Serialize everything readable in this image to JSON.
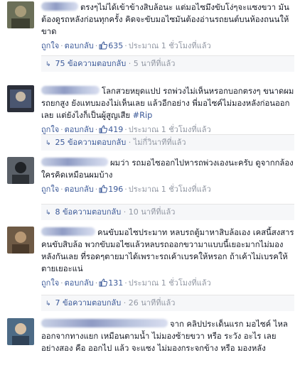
{
  "comments": [
    {
      "text": "ตรงๆไม่ได้เข้าข้างสิบล้อนะ แต่มอไซมึงขับโง่ๆจะแซงขวา มันต้องดูรถหลังก่อนทุกครั้ง คิดจะขับมอไซมันต้องอ่านรถยนต์บนห้องถนนให้ขาด",
      "like_label": "ถูกใจ",
      "reply_label": "ตอบกลับ",
      "likes": "635",
      "time": "ประมาณ 1 ชั่วโมงที่แล้ว",
      "replies_count": "75 ข้อความตอบกลับ",
      "replies_time": "5 นาทีที่แล้ว"
    },
    {
      "text": "โลกสวยหยุดแปป รถพ่วงไม่เห็นหรอกบอกตรงๆ ขนาดผมรถยกสูง ยังแทบมองไม่เห็นเลย แล้วอีกอย่าง พี่มอไซค์ไม่มองหลังก่อนออกเลย แต่ยังไงก็เป็นผู้สูญเสีย",
      "hashtag": "#Rip",
      "like_label": "ถูกใจ",
      "reply_label": "ตอบกลับ",
      "likes": "419",
      "time": "ประมาณ 1 ชั่วโมงที่แล้ว",
      "replies_count": "25 ข้อความตอบกลับ",
      "replies_time": "ไม่กี่วินาทีที่แล้ว"
    },
    {
      "text": "ผมว่า รถมอไซออกไปหารถพ่วงเองนะครับ ดูจากกล้อง ใครคิดเหมือนผมบ้าง",
      "like_label": "ถูกใจ",
      "reply_label": "ตอบกลับ",
      "likes": "196",
      "time": "ประมาณ 1 ชั่วโมงที่แล้ว",
      "replies_count": "8 ข้อความตอบกลับ",
      "replies_time": "10 นาทีที่แล้ว"
    },
    {
      "text": "คนขับมอไซประมาท หลบรถตู้มาหาสิบล้อเอง เคสนี้สงสารคนขับสิบล้อ พวกขับมอไซแล้วหลบรถออกขวามาแบบนี้เยอะมากไม่มองหลังกันเลย ที่รอดๆตายมาได้เพราะรถเค้าเบรคให้หรอก ถ้าเค้าไม่เบรคให้ตายเยอะแน่",
      "like_label": "ถูกใจ",
      "reply_label": "ตอบกลับ",
      "likes": "131",
      "time": "ประมาณ 1 ชั่วโมงที่แล้ว",
      "replies_count": "7 ข้อความตอบกลับ",
      "replies_time": "26 นาทีที่แล้ว"
    },
    {
      "text": "จาก คลิปประเด็นแรก มอไซค์ ไหลออกจากทางแยก เหมือนตามน้ำ ไม่มองซ้ายขวา หรือ ระวัง อะไร เลย อย่างสอง คือ ออกไป แล้ว จะแซง ไม่มองกระจกข้าง หรือ มองหลัง"
    }
  ],
  "colors": {
    "link": "#3b5998",
    "meta": "#9197a3",
    "reply_bg": "#f6f7f9"
  },
  "icons": {
    "like": "thumbs-up-icon",
    "replies": "reply-arrow-icon"
  }
}
